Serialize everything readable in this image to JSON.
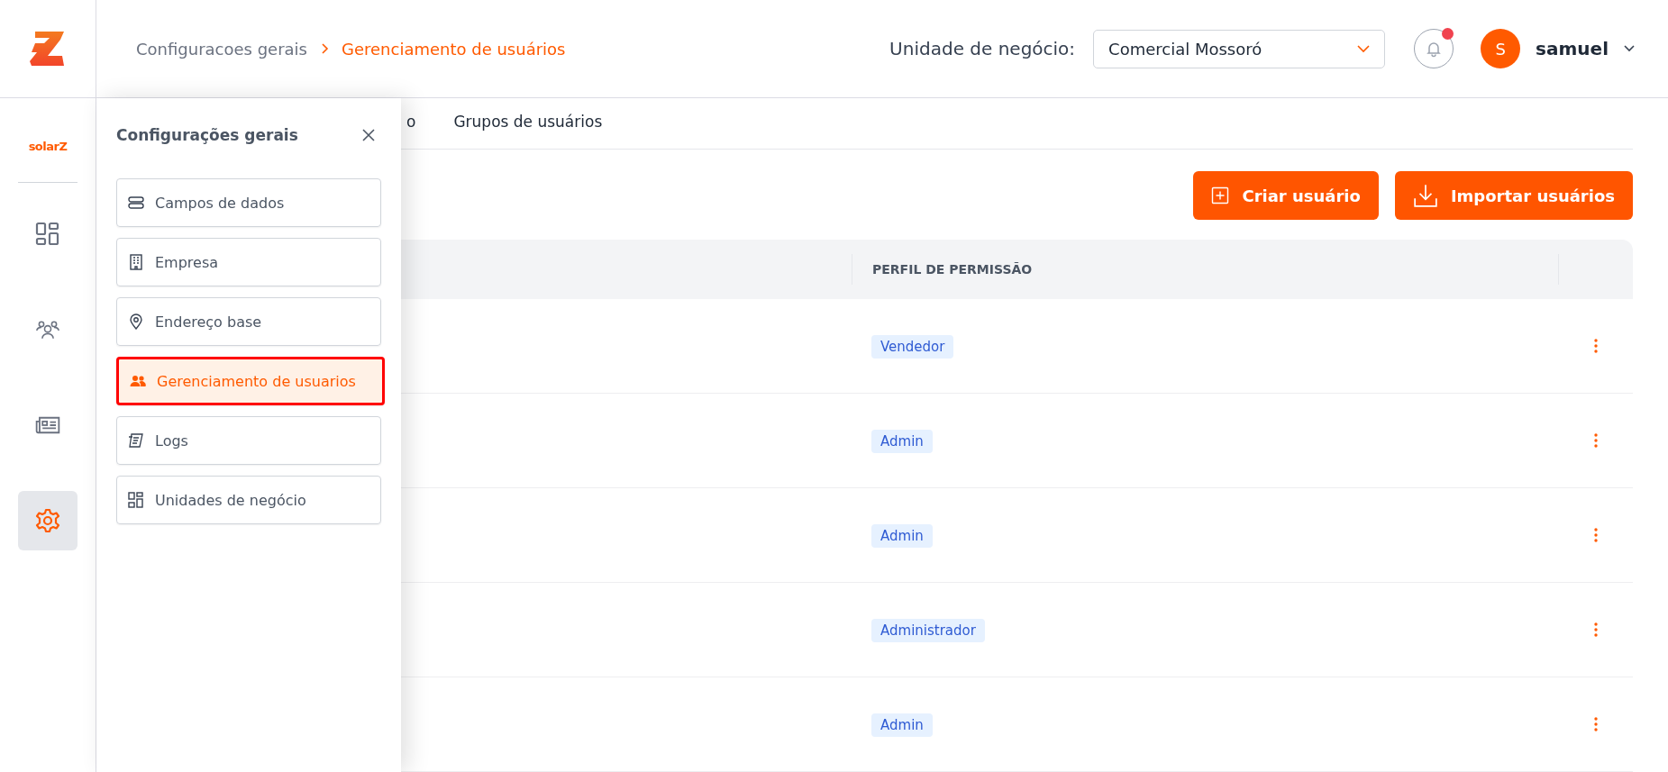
{
  "header": {
    "breadcrumb": [
      {
        "label": "Configuracoes gerais",
        "current": false
      },
      {
        "label": "Gerenciamento de usuários",
        "current": true
      }
    ],
    "business_unit": {
      "label": "Unidade de negócio:",
      "value": "Comercial Mossoró"
    },
    "notifications": {
      "unread": true
    },
    "user": {
      "initial": "S",
      "name": "samuel"
    }
  },
  "rail": {
    "brand": "solarZ",
    "items": [
      {
        "kind": "dashboard",
        "selected": false
      },
      {
        "kind": "people",
        "selected": false
      },
      {
        "kind": "news",
        "selected": false
      },
      {
        "kind": "settings",
        "selected": true
      }
    ]
  },
  "panel": {
    "title": "Configurações gerais",
    "items": [
      {
        "kind": "fields",
        "label": "Campos de dados",
        "selected": false
      },
      {
        "kind": "building",
        "label": "Empresa",
        "selected": false
      },
      {
        "kind": "pin",
        "label": "Endereço base",
        "selected": false
      },
      {
        "kind": "users",
        "label": "Gerenciamento de usuarios",
        "selected": true
      },
      {
        "kind": "logs",
        "label": "Logs",
        "selected": false
      },
      {
        "kind": "units",
        "label": "Unidades de negócio",
        "selected": false
      }
    ]
  },
  "tabs": [
    {
      "label": "o",
      "selected": false
    },
    {
      "label": "Grupos de usuários",
      "selected": false
    }
  ],
  "actions": [
    {
      "kind": "create",
      "label": "Criar usuário"
    },
    {
      "kind": "import",
      "label": "Importar usuários"
    }
  ],
  "table": {
    "columns": [
      "PERFIL DE PERMISSÃO"
    ],
    "rows": [
      {
        "profile": "Vendedor"
      },
      {
        "profile": "Admin"
      },
      {
        "profile": "Admin"
      },
      {
        "profile": "Administrador"
      },
      {
        "profile": "Admin"
      }
    ]
  }
}
